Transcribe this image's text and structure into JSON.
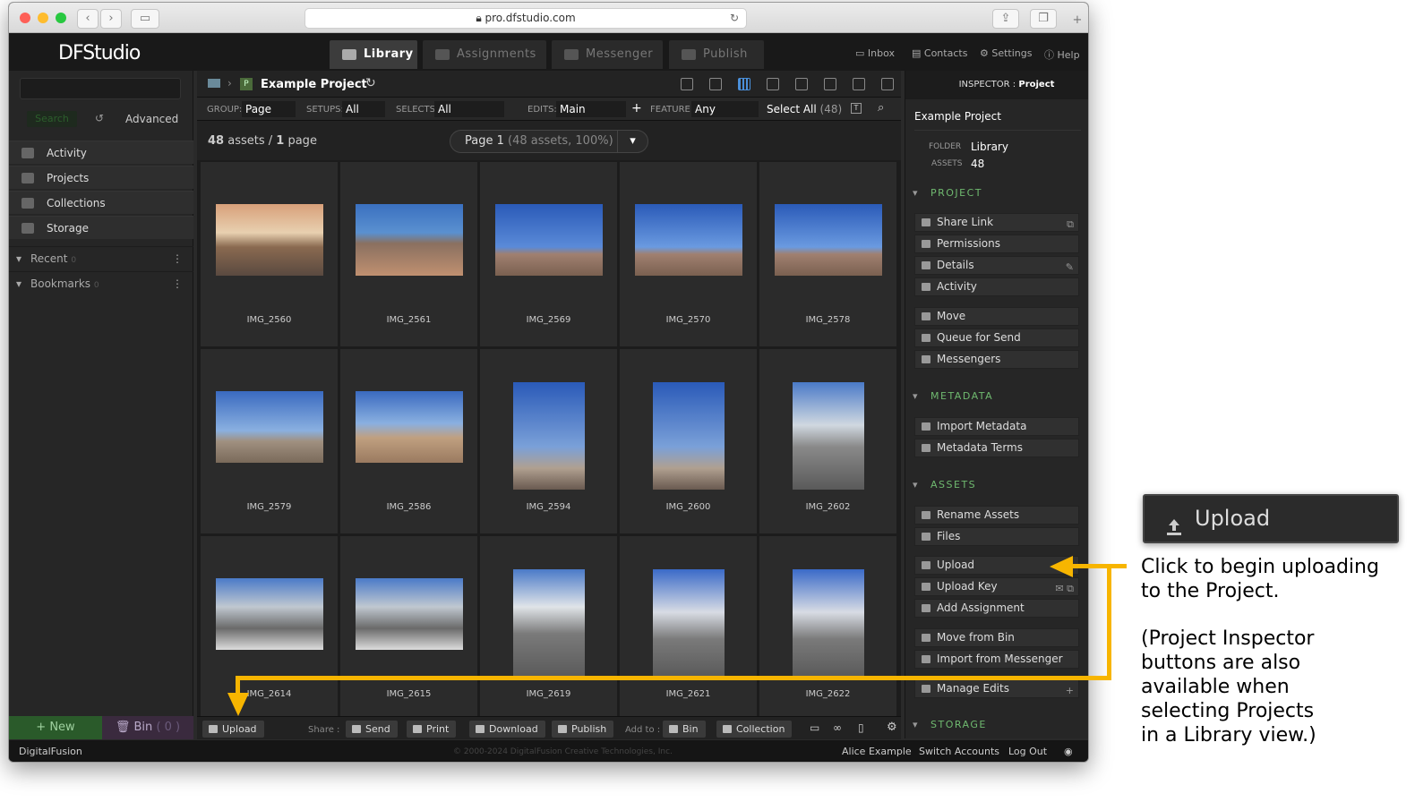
{
  "browser": {
    "url": "pro.dfstudio.com"
  },
  "app": {
    "logo": "DFStudio"
  },
  "nav": {
    "tabs": [
      "Library",
      "Assignments",
      "Messenger",
      "Publish"
    ],
    "links": [
      "Inbox",
      "Contacts",
      "Settings",
      "Help"
    ]
  },
  "sidebar": {
    "search_btn": "Search",
    "advanced": "Advanced",
    "items": [
      "Activity",
      "Projects",
      "Collections",
      "Storage"
    ],
    "sections": [
      {
        "label": "Recent",
        "count": "0"
      },
      {
        "label": "Bookmarks",
        "count": "0"
      }
    ],
    "new_btn": "+ New",
    "bin_btn": "Bin",
    "bin_count": "( 0 )"
  },
  "main": {
    "project_title": "Example Project",
    "filters": {
      "group_label": "GROUP:",
      "group": "Page",
      "setups_label": "SETUPS:",
      "setups": "All",
      "selects_label": "SELECTS:",
      "selects": "All",
      "edits_label": "EDITS:",
      "edits": "Main",
      "feature_label": "FEATURE:",
      "feature": "Any",
      "select_all": "Select All",
      "select_all_count": "(48)"
    },
    "assets_count": "48",
    "assets_label": "assets /",
    "page_count": "1",
    "page_label": "page",
    "page_select": "Page 1",
    "page_select_detail": "(48 assets, 100%)",
    "assets": [
      "IMG_2560",
      "IMG_2561",
      "IMG_2569",
      "IMG_2570",
      "IMG_2578",
      "IMG_2579",
      "IMG_2586",
      "IMG_2594",
      "IMG_2600",
      "IMG_2602",
      "IMG_2614",
      "IMG_2615",
      "IMG_2619",
      "IMG_2621",
      "IMG_2622"
    ],
    "bottom": {
      "upload": "Upload",
      "share_label": "Share :",
      "send": "Send",
      "print": "Print",
      "download": "Download",
      "publish": "Publish",
      "addto_label": "Add to :",
      "bin": "Bin",
      "collection": "Collection"
    }
  },
  "inspector": {
    "title_prefix": "INSPECTOR :",
    "title": "Project",
    "name": "Example Project",
    "folder_label": "FOLDER",
    "folder": "Library",
    "assets_label": "ASSETS",
    "assets": "48",
    "sections": {
      "project": "PROJECT",
      "metadata": "METADATA",
      "assets": "ASSETS",
      "storage": "STORAGE"
    },
    "project_btns": [
      "Share Link",
      "Permissions",
      "Details",
      "Activity",
      "Move",
      "Queue for Send",
      "Messengers"
    ],
    "metadata_btns": [
      "Import Metadata",
      "Metadata Terms"
    ],
    "asset_btns": [
      "Rename Assets",
      "Files",
      "Upload",
      "Upload Key",
      "Add Assignment",
      "Move from Bin",
      "Import from Messenger",
      "Manage Edits"
    ]
  },
  "footer": {
    "brand": "DigitalFusion",
    "copyright": "© 2000-2024 DigitalFusion Creative Technologies, Inc.",
    "user": "Alice Example",
    "switch": "Switch Accounts",
    "logout": "Log Out"
  },
  "callout": {
    "label": "Upload",
    "note1": [
      "Click to begin uploading",
      "to the Project."
    ],
    "note2": [
      "(Project Inspector",
      "buttons are also",
      "available when",
      "selecting Projects",
      "in a Library view.)"
    ]
  },
  "colors": {
    "accent": "#f7b500",
    "section_green": "#6fb96f"
  }
}
